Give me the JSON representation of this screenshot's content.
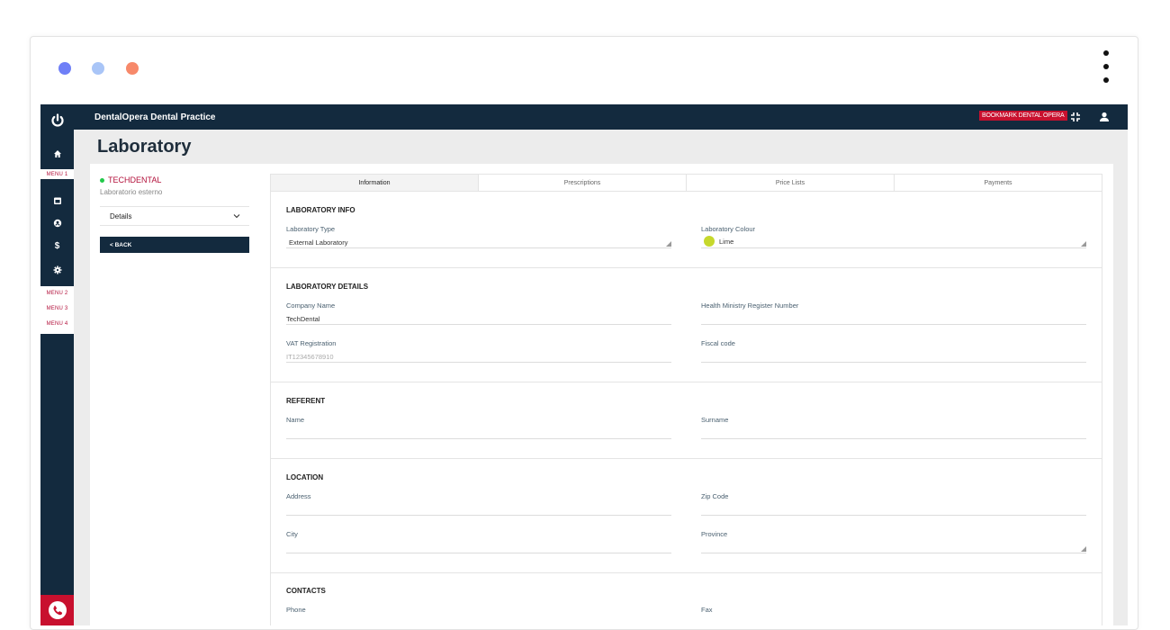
{
  "window": {
    "dot_colors": [
      "#6f7ff7",
      "#a9c5f7",
      "#f7896a"
    ]
  },
  "header": {
    "brand": "DentalOpera Dental Practice",
    "bookmark": "BOOKMARK DENTAL OPERA"
  },
  "sidebar": {
    "menu1": "MENU 1",
    "menu2": "MENU 2",
    "menu3": "MENU 3",
    "menu4": "MENU 4"
  },
  "page": {
    "title": "Laboratory"
  },
  "laboratory": {
    "name": "TECHDENTAL",
    "subtitle": "Laboratorio esterno",
    "details_select": "Details",
    "back_label": "< BACK"
  },
  "tabs": [
    "Information",
    "Prescriptions",
    "Price Lists",
    "Payments"
  ],
  "sections": {
    "info": {
      "title": "LABORATORY INFO",
      "type_label": "Laboratory Type",
      "type_value": "External Laboratory",
      "colour_label": "Laboratory Colour",
      "colour_value": "Lime",
      "colour_hex": "#c6d82c"
    },
    "details": {
      "title": "LABORATORY DETAILS",
      "company_label": "Company Name",
      "company_value": "TechDental",
      "health_label": "Health Ministry Register Number",
      "vat_label": "VAT Registration",
      "vat_placeholder": "IT12345678910",
      "fiscal_label": "Fiscal code"
    },
    "referent": {
      "title": "REFERENT",
      "name_label": "Name",
      "surname_label": "Surname"
    },
    "location": {
      "title": "LOCATION",
      "address_label": "Address",
      "zip_label": "Zip Code",
      "city_label": "City",
      "province_label": "Province"
    },
    "contacts": {
      "title": "CONTACTS",
      "phone_label": "Phone",
      "fax_label": "Fax"
    }
  }
}
